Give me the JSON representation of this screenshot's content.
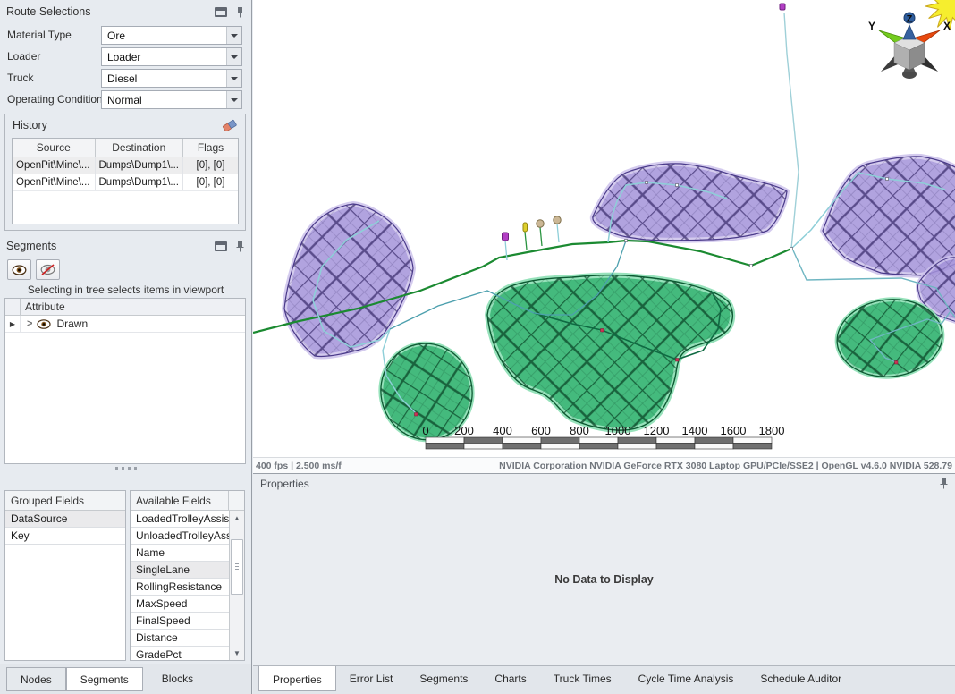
{
  "route_selections": {
    "title": "Route Selections",
    "fields": [
      {
        "label": "Material Type",
        "value": "Ore"
      },
      {
        "label": "Loader",
        "value": "Loader"
      },
      {
        "label": "Truck",
        "value": "Diesel"
      },
      {
        "label": "Operating Conditions",
        "value": "Normal"
      }
    ]
  },
  "history": {
    "title": "History",
    "columns": [
      "Source",
      "Destination",
      "Flags"
    ],
    "rows": [
      {
        "source": "OpenPit\\Mine\\...",
        "destination": "Dumps\\Dump1\\...",
        "flags": "[0], [0]"
      },
      {
        "source": "OpenPit\\Mine\\...",
        "destination": "Dumps\\Dump1\\...",
        "flags": "[0], [0]"
      }
    ]
  },
  "segments_panel": {
    "title": "Segments",
    "hint": "Selecting in tree selects items in viewport",
    "tree_header": "Attribute",
    "rows": [
      {
        "label": "Drawn"
      }
    ]
  },
  "fields_panels": {
    "grouped": {
      "title": "Grouped Fields",
      "items": [
        "DataSource",
        "Key"
      ],
      "selected": "DataSource"
    },
    "available": {
      "title": "Available Fields",
      "items": [
        "LoadedTrolleyAssist",
        "UnloadedTrolleyAss...",
        "Name",
        "SingleLane",
        "RollingResistance",
        "MaxSpeed",
        "FinalSpeed",
        "Distance",
        "GradePct"
      ],
      "selected": "SingleLane"
    }
  },
  "left_tabs": [
    {
      "label": "Nodes",
      "active": false
    },
    {
      "label": "Segments",
      "active": true
    },
    {
      "label": "Blocks",
      "active": false
    }
  ],
  "viewport": {
    "stats": "400 fps | 2.500 ms/f",
    "renderer": "NVIDIA Corporation NVIDIA GeForce RTX 3080 Laptop GPU/PCIe/SSE2 | OpenGL v4.6.0 NVIDIA 528.79",
    "scale_ticks": [
      "0",
      "200",
      "400",
      "600",
      "800",
      "1000",
      "1200",
      "1400",
      "1600",
      "1800"
    ],
    "axis": {
      "x": "X",
      "y": "Y",
      "z": "Z"
    },
    "colors": {
      "pit_green": "#2fae6e",
      "dump_purple": "#9a88d4",
      "road_main_green": "#1b8a31",
      "road_secondary_teal": "#7fc0ca",
      "sun_yellow": "#f6ee2e"
    }
  },
  "properties_panel": {
    "title": "Properties",
    "empty_text": "No Data to Display"
  },
  "bottom_tabs": [
    {
      "label": "Properties",
      "active": true
    },
    {
      "label": "Error List",
      "active": false
    },
    {
      "label": "Segments",
      "active": false
    },
    {
      "label": "Charts",
      "active": false
    },
    {
      "label": "Truck Times",
      "active": false
    },
    {
      "label": "Cycle Time Analysis",
      "active": false
    },
    {
      "label": "Schedule Auditor",
      "active": false
    }
  ]
}
